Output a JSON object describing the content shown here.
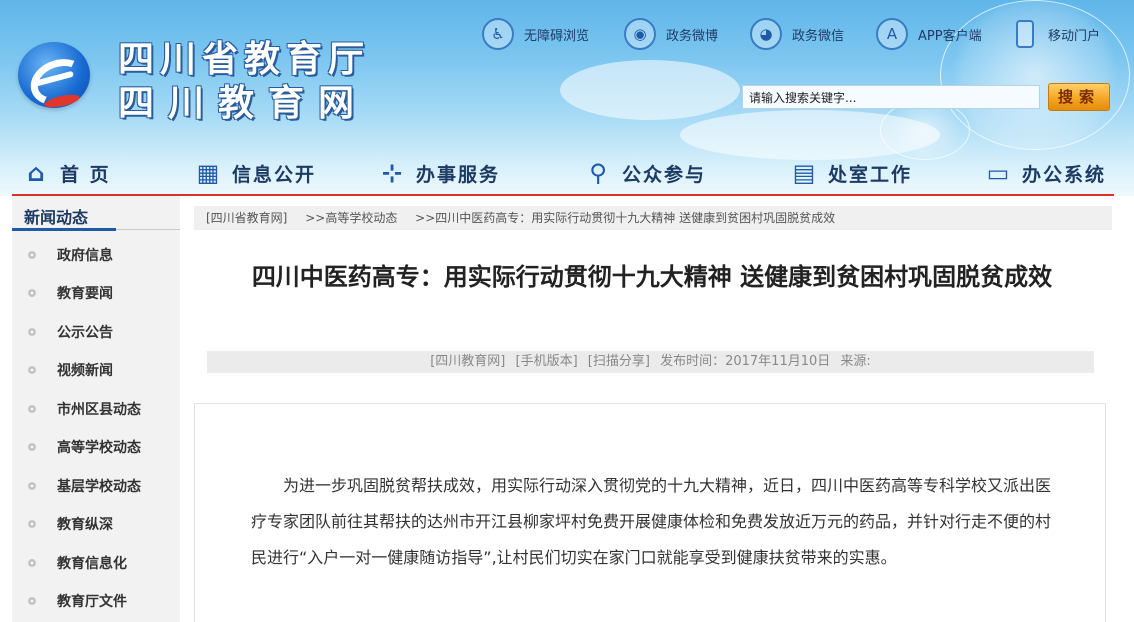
{
  "header": {
    "title_line1": "四川省教育厅",
    "title_line2": "四川教育网",
    "top_links": [
      {
        "label": "无障碍浏览",
        "icon": "accessibility-icon"
      },
      {
        "label": "政务微博",
        "icon": "weibo-icon"
      },
      {
        "label": "政务微信",
        "icon": "wechat-icon"
      },
      {
        "label": "APP客户端",
        "icon": "app-store-icon"
      },
      {
        "label": "移动门户",
        "icon": "mobile-icon"
      }
    ],
    "search": {
      "value": "请输入搜索关键字...",
      "button_label": "搜索"
    }
  },
  "nav": {
    "items": [
      {
        "label": "首 页",
        "icon": "home-icon"
      },
      {
        "label": "信息公开",
        "icon": "building-icon"
      },
      {
        "label": "办事服务",
        "icon": "service-icon"
      },
      {
        "label": "公众参与",
        "icon": "user-search-icon"
      },
      {
        "label": "处室工作",
        "icon": "calendar-icon"
      },
      {
        "label": "办公系统",
        "icon": "monitor-icon"
      }
    ]
  },
  "sidebar": {
    "heading": "新闻动态",
    "items": [
      {
        "label": "政府信息"
      },
      {
        "label": "教育要闻"
      },
      {
        "label": "公示公告"
      },
      {
        "label": "视频新闻"
      },
      {
        "label": "市州区县动态"
      },
      {
        "label": "高等学校动态"
      },
      {
        "label": "基层学校动态"
      },
      {
        "label": "教育纵深"
      },
      {
        "label": "教育信息化"
      },
      {
        "label": "教育厅文件"
      }
    ]
  },
  "breadcrumb": {
    "items": [
      "[四川省教育网]",
      ">>高等学校动态",
      ">>四川中医药高专：用实际行动贯彻十九大精神 送健康到贫困村巩固脱贫成效"
    ]
  },
  "article": {
    "title": "四川中医药高专：用实际行动贯彻十九大精神 送健康到贫困村巩固脱贫成效",
    "meta": {
      "source_link": "[四川教育网]",
      "mobile_link": "[手机版本]",
      "share_link": "[扫描分享]",
      "published": "发布时间：2017年11月10日",
      "origin": "来源:"
    },
    "body": "为进一步巩固脱贫帮扶成效，用实际行动深入贯彻党的十九大精神，近日，四川中医药高等专科学校又派出医疗专家团队前往其帮扶的达州市开江县柳家坪村免费开展健康体检和免费发放近万元的药品，并针对行走不便的村民进行“入户一对一健康随访指导”,让村民们切实在家门口就能享受到健康扶贫带来的实惠。"
  },
  "colors": {
    "brand_blue": "#1f5aa6",
    "nav_red_line": "#d9322a",
    "search_orange": "#f5a623"
  }
}
